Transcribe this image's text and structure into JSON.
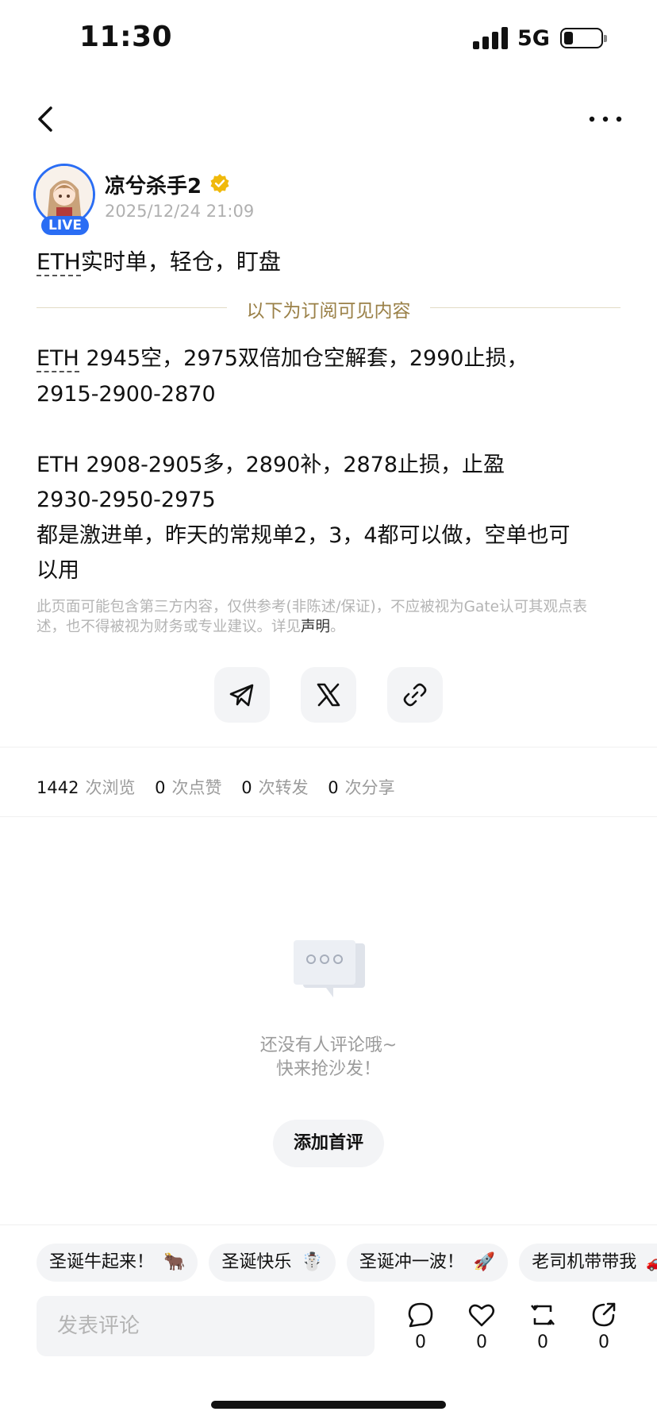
{
  "status_bar": {
    "time": "11:30",
    "network": "5G",
    "battery_level": 0.25
  },
  "author": {
    "name": "凉兮杀手2",
    "timestamp": "2025/12/24 21:09",
    "live_badge": "LIVE"
  },
  "post": {
    "headline_ticker": "ETH",
    "headline_rest": "实时单，轻仓，盯盘",
    "subscriber_divider": "以下为订阅可见内容",
    "line1_ticker": "ETH",
    "line1_rest": " 2945空，2975双倍加仓空解套，2990止损，",
    "line2": "2915-2900-2870",
    "line3": "ETH 2908-2905多，2890补，2878止损，止盈",
    "line4": "2930-2950-2975",
    "line5": "都是激进单，昨天的常规单2，3，4都可以做，空单也可",
    "line6": "以用",
    "disclaimer_line1": "此页面可能包含第三方内容，仅供参考(非陈述/保证)，不应被视为Gate认可其观点表",
    "disclaimer_line2": "述，也不得被视为财务或专业建议。详见",
    "disclaimer_link": "声明",
    "disclaimer_end": "。"
  },
  "share": {
    "icons": [
      "telegram-icon",
      "x-icon",
      "link-icon"
    ]
  },
  "stats": {
    "views": "1442",
    "views_label": "次浏览",
    "likes": "0",
    "likes_label": "次点赞",
    "reposts": "0",
    "reposts_label": "次转发",
    "shares": "0",
    "shares_label": "次分享"
  },
  "comments_empty": {
    "line1": "还没有人评论哦~",
    "line2": "快来抢沙发！",
    "button": "添加首评"
  },
  "chips": [
    {
      "label": "圣诞牛起来！",
      "emoji": "🐂"
    },
    {
      "label": "圣诞快乐",
      "emoji": "☃️"
    },
    {
      "label": "圣诞冲一波！",
      "emoji": "🚀"
    },
    {
      "label": "老司机带带我",
      "emoji": "🚗"
    }
  ],
  "bottom_bar": {
    "comment_placeholder": "发表评论",
    "comment_count": "0",
    "like_count": "0",
    "repost_count": "0",
    "share_count": "0"
  },
  "colors": {
    "accent_blue": "#2a6df4",
    "gold": "#9a8047",
    "verified": "#f0b90b"
  }
}
